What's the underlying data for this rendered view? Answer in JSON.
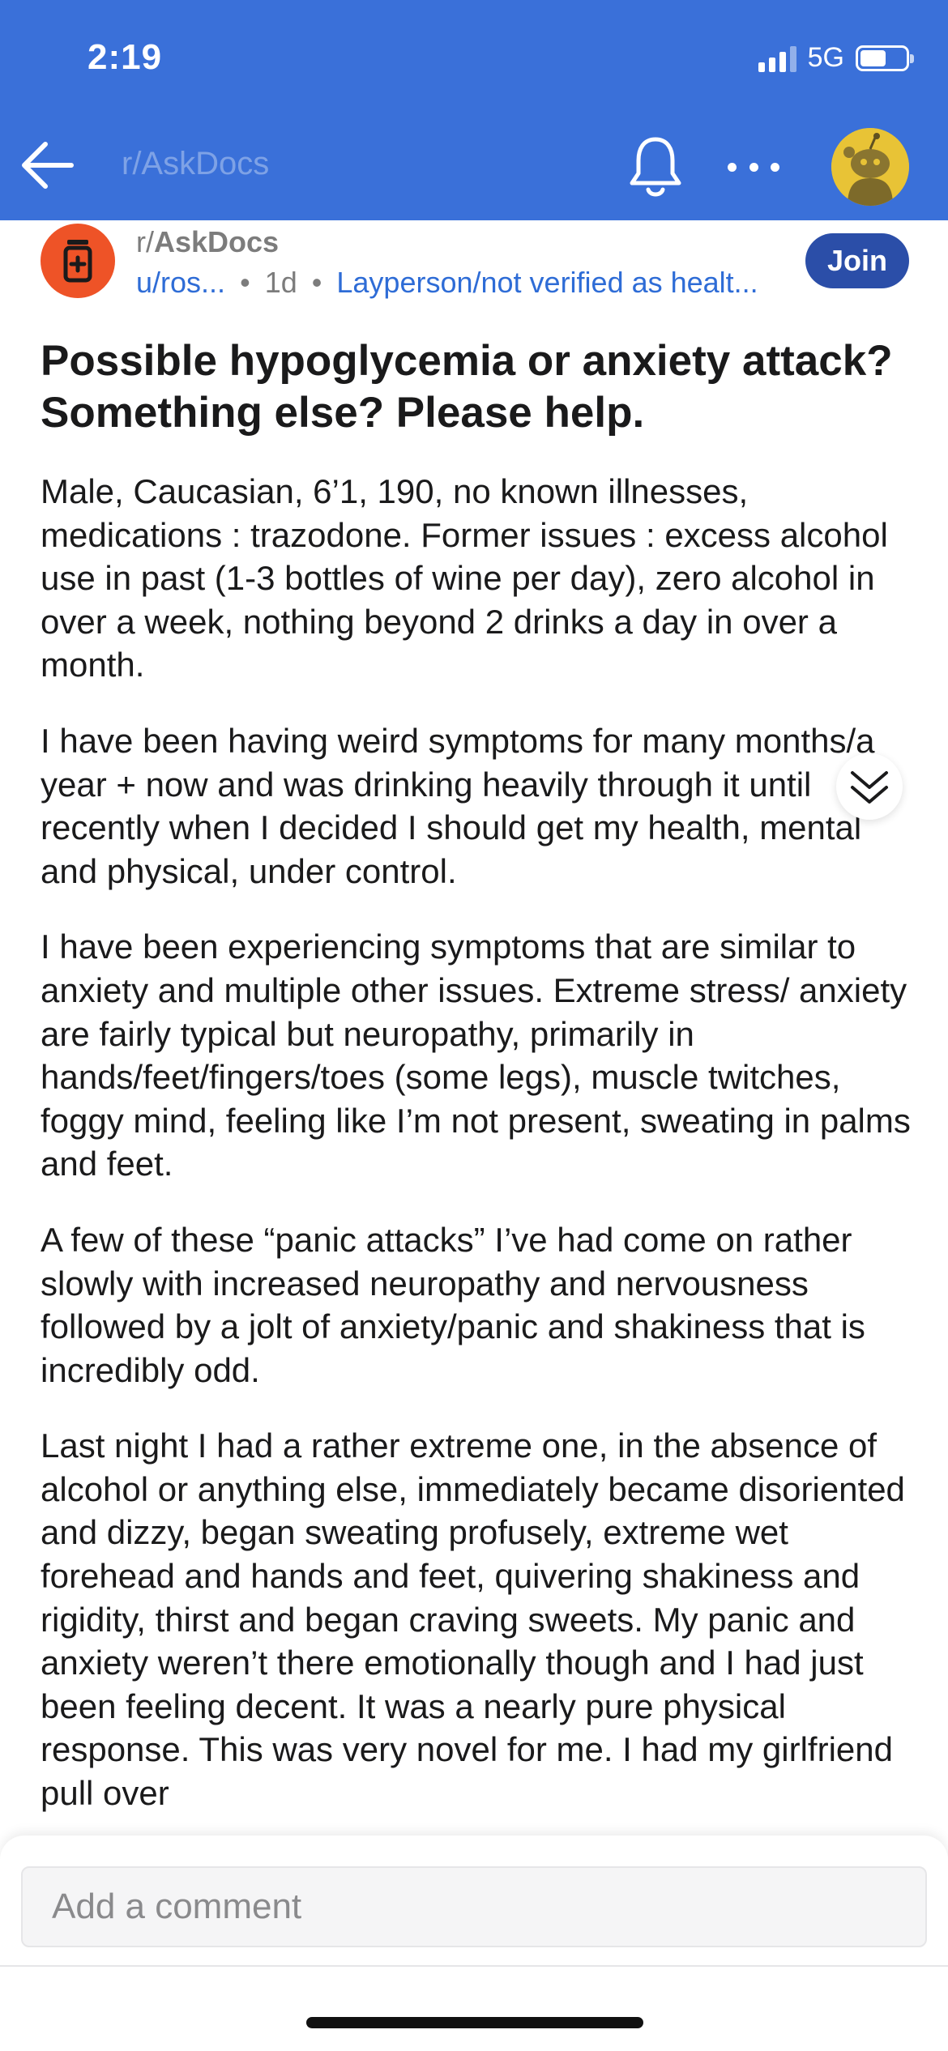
{
  "status_bar": {
    "time": "2:19",
    "network": "5G",
    "battery_level": 0.58
  },
  "nav": {
    "subreddit_title": "r/AskDocs",
    "icons": [
      "back-arrow-icon",
      "bell-icon",
      "more-icon",
      "avatar"
    ]
  },
  "post": {
    "subreddit_prefix": "r/",
    "subreddit_name": "AskDocs",
    "author": "u/ros...",
    "separator": "•",
    "age": "1d",
    "flair": "Layperson/not verified as healt...",
    "join_label": "Join",
    "title": "Possible hypoglycemia or anxiety attack? Something else? Please help.",
    "paragraphs": [
      "Male, Caucasian, 6’1, 190, no known illnesses, medications : trazodone. Former issues : excess alcohol use in past (1-3 bottles of wine per day), zero alcohol in over a week, nothing beyond 2 drinks a day in over a month.",
      "I have been having weird symptoms for many months/a year + now and was drinking heavily through it until recently when I decided I should get my health, mental and physical, under control.",
      "I have been experiencing symptoms that are similar to anxiety and multiple other issues. Extreme stress/ anxiety are fairly typical but neuropathy, primarily in hands/feet/fingers/toes (some legs), muscle twitches, foggy mind, feeling like I’m not present, sweating in palms and feet.",
      "A few of these “panic attacks” I’ve had come on rather slowly with increased neuropathy and nervousness followed by a jolt of anxiety/panic and shakiness that is incredibly odd.",
      "Last night I had a rather extreme one, in the absence of alcohol or anything else, immediately became disoriented and dizzy, began sweating profusely, extreme wet forehead and hands and feet, quivering shakiness and rigidity, thirst and began craving sweets. My panic and anxiety weren’t there emotionally though and I had just been feeling decent. It was a nearly pure physical response. This was very novel for me. I had my girlfriend pull over"
    ]
  },
  "comment_bar": {
    "placeholder": "Add a comment"
  },
  "colors": {
    "header_blue": "#3a70d9",
    "join_blue": "#2b4ea8",
    "link_blue": "#2e6cd6",
    "subreddit_icon_orange": "#ee5327",
    "avatar_yellow": "#e8c336"
  }
}
